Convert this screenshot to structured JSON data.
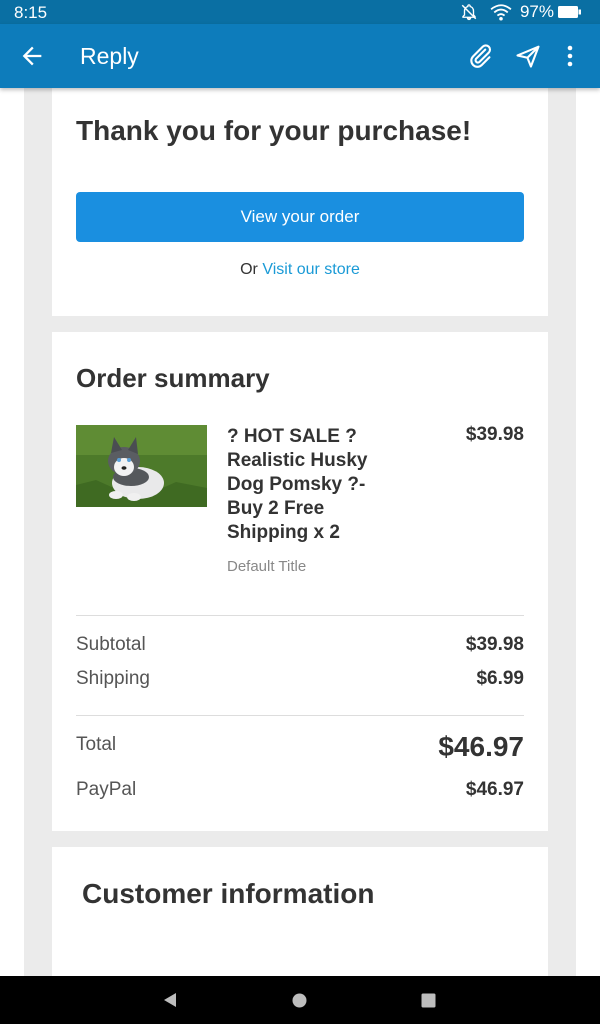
{
  "status_bar": {
    "time": "8:15",
    "battery_percent": "97%",
    "icons": [
      "notifications-off-icon",
      "wifi-icon",
      "battery-icon"
    ]
  },
  "app_bar": {
    "title": "Reply",
    "background_color": "#0d7cbb",
    "actions": [
      "back-arrow-icon",
      "attach-icon",
      "send-icon",
      "more-vert-icon"
    ]
  },
  "thanks_card": {
    "title": "Thank you for your purchase!",
    "button_label": "View your order",
    "or_text": "Or",
    "store_link": "Visit our store",
    "button_color": "#1a8fe0"
  },
  "order_summary": {
    "title": "Order summary",
    "item": {
      "name": "? HOT SALE ? Realistic Husky Dog Pomsky ?- Buy 2 Free Shipping x 2",
      "variant": "Default Title",
      "price": "$39.98",
      "image": "husky-puppy-photo"
    },
    "subtotal_label": "Subtotal",
    "subtotal_value": "$39.98",
    "shipping_label": "Shipping",
    "shipping_value": "$6.99",
    "total_label": "Total",
    "total_value": "$46.97",
    "payment_label": "PayPal",
    "payment_value": "$46.97"
  },
  "customer_card": {
    "title": "Customer information"
  },
  "nav_bar": {
    "buttons": [
      "nav-back-icon",
      "nav-home-icon",
      "nav-recents-icon"
    ]
  }
}
